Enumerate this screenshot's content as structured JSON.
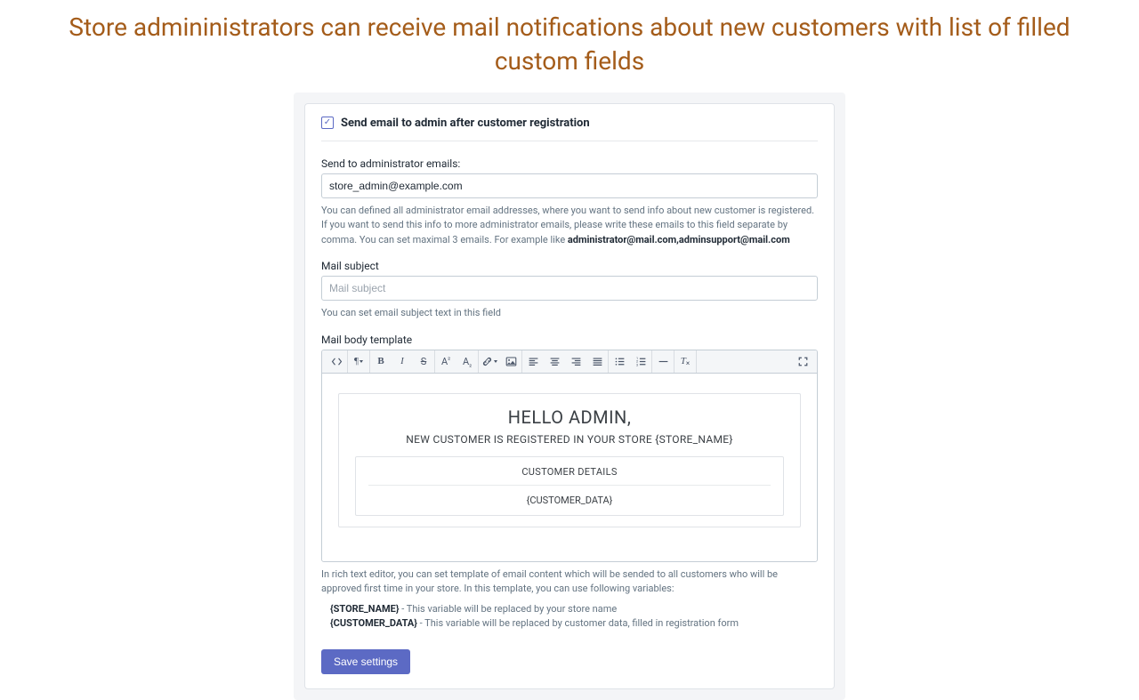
{
  "page_title": "Store admininistrators can receive mail notifications about new customers with list of filled custom fields",
  "section": {
    "checkbox_checked": true,
    "title": "Send email to admin after customer registration"
  },
  "emails": {
    "label": "Send to administrator emails:",
    "value": "store_admin@example.com",
    "help_prefix": "You can defined all administrator email addresses, where you want to send info about new customer is registered. If you want to send this info to more administrator emails, please write these emails to this field separate by comma. You can set maximal 3 emails. For example like ",
    "help_bold": "administrator@mail.com,adminsupport@mail.com"
  },
  "subject": {
    "label": "Mail subject",
    "placeholder": "Mail subject",
    "help": "You can set email subject text in this field"
  },
  "body": {
    "label": "Mail body template",
    "preview": {
      "greeting": "HELLO ADMIN,",
      "line": "NEW CUSTOMER IS REGISTERED IN YOUR STORE {STORE_NAME}",
      "box_title": "CUSTOMER DETAILS",
      "box_content": "{CUSTOMER_DATA}"
    },
    "help": "In rich text editor, you can set template of email content which will be sended to all customers who will be approved first time in your store. In this template, you can use following variables:",
    "vars": [
      {
        "name": "{STORE_NAME}",
        "desc": " - This variable will be replaced by your store name"
      },
      {
        "name": "{CUSTOMER_DATA}",
        "desc": " - This variable will be replaced by customer data, filled in registration form"
      }
    ]
  },
  "toolbar": {
    "code": "code-view",
    "paragraph": "paragraph-style",
    "bold": "bold",
    "italic": "italic",
    "strike": "strikethrough",
    "superscript": "superscript",
    "subscript": "subscript",
    "link": "link",
    "image": "image",
    "align_left": "align-left",
    "align_center": "align-center",
    "align_right": "align-right",
    "align_justify": "align-justify",
    "ul": "unordered-list",
    "ol": "ordered-list",
    "hr": "horizontal-rule",
    "clear": "clear-format",
    "expand": "fullscreen"
  },
  "save": "Save settings"
}
